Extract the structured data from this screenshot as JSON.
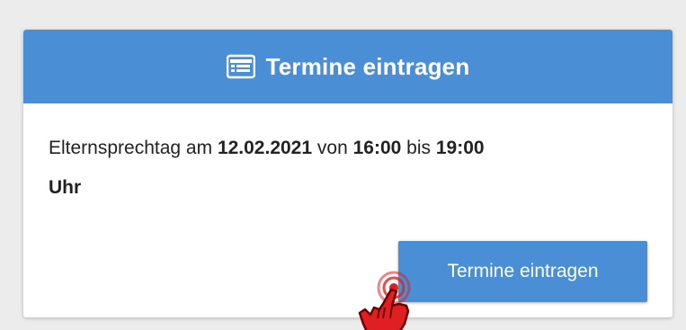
{
  "card": {
    "title": "Termine eintragen",
    "header_icon": "list-icon",
    "text": {
      "prefix": "Elternsprechtag am",
      "date": "12.02.2021",
      "from_word": "von",
      "start_time": "16:00",
      "to_word": "bis",
      "end_time": "19:00",
      "unit": "Uhr"
    },
    "button_label": "Termine eintragen"
  },
  "pointer_icon": "hand-pointer-icon",
  "colors": {
    "primary": "#4a8fd6",
    "background": "#ececec",
    "card": "#ffffff",
    "pointer": "#e02020"
  }
}
